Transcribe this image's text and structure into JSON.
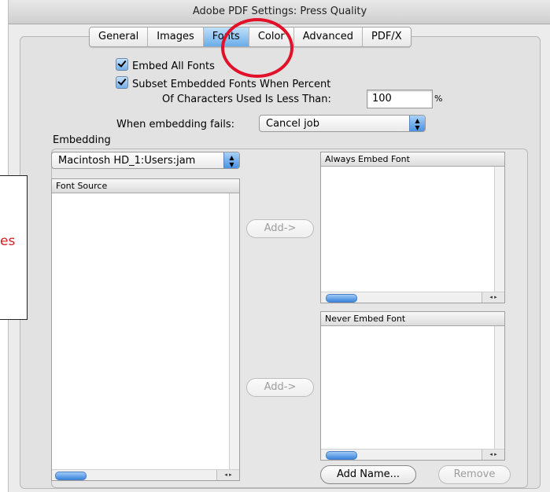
{
  "window": {
    "title": "Adobe PDF Settings: Press Quality"
  },
  "tabs": [
    "General",
    "Images",
    "Fonts",
    "Color",
    "Advanced",
    "PDF/X"
  ],
  "active_tab": "Fonts",
  "options": {
    "embed_all": "Embed All Fonts",
    "subset_line1": "Subset Embedded Fonts When Percent",
    "subset_line2": "Of Characters Used Is Less Than:",
    "subset_value": "100",
    "percent": "%",
    "fails_label": "When embedding fails:",
    "fails_value": "Cancel job"
  },
  "embedding": {
    "label": "Embedding",
    "source_popup": "Macintosh HD_1:Users:jam",
    "font_source_header": "Font Source",
    "always_header": "Always Embed Font",
    "never_header": "Never Embed Font",
    "add_always": "Add->",
    "add_never": "Add->",
    "add_name": "Add Name...",
    "remove": "Remove"
  },
  "callout": {
    "text": "es"
  },
  "colors": {
    "annotation_red": "#e3102a",
    "aqua_blue": "#69adea"
  }
}
